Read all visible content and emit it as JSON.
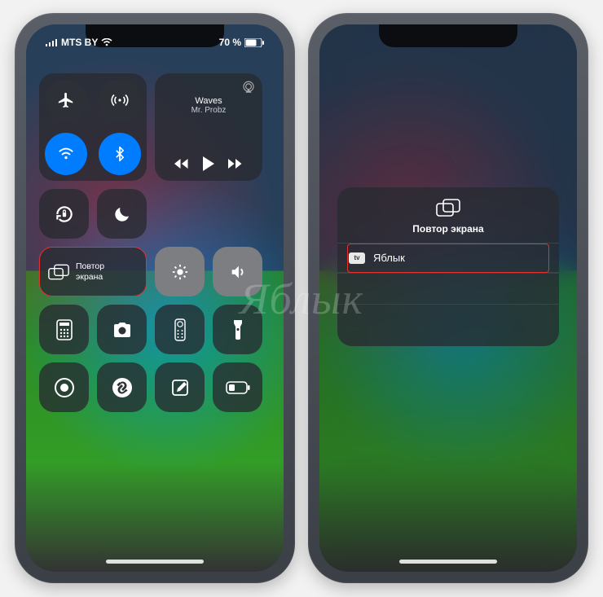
{
  "watermark": "Яблык",
  "statusbar": {
    "carrier": "MTS BY",
    "battery": "70 %"
  },
  "controlCenter": {
    "media": {
      "title": "Waves",
      "artist": "Mr. Probz"
    },
    "screenMirror": {
      "line1": "Повтор",
      "line2": "экрана"
    }
  },
  "mirrorModal": {
    "title": "Повтор экрана",
    "device": "Яблык"
  }
}
